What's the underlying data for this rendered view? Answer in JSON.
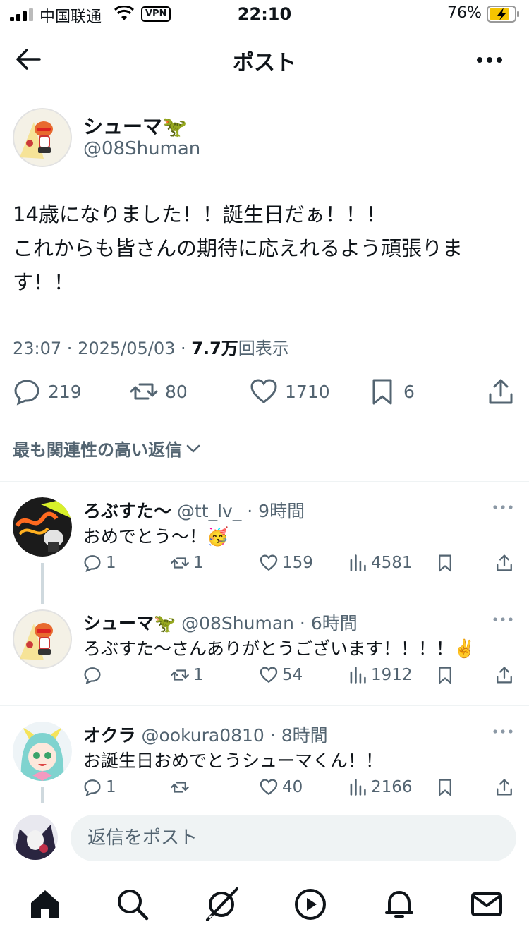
{
  "status": {
    "carrier": "中国联通",
    "vpn": "VPN",
    "time": "22:10",
    "battery": "76%"
  },
  "header": {
    "title": "ポスト"
  },
  "post": {
    "author_name": "シューマ🦖",
    "author_handle": "@08Shuman",
    "text_line1": "14歳になりました！！誕生日だぁ！！！",
    "text_line2": "これからも皆さんの期待に応えれるよう頑張りま",
    "text_line3": "す！！",
    "time": "23:07",
    "date": "2025/05/03",
    "views_count": "7.7万",
    "views_label": "回表示",
    "replies": "219",
    "reposts": "80",
    "likes": "1710",
    "bookmarks": "6"
  },
  "sort": {
    "label": "最も関連性の高い返信"
  },
  "replies": [
    {
      "name": "ろぶすた〜",
      "handle": "@tt_lv_",
      "age": "9時間",
      "text": "おめでとう〜！🥳",
      "replies": "1",
      "reposts": "1",
      "likes": "159",
      "views": "4581"
    },
    {
      "name": "シューマ🦖",
      "handle": "@08Shuman",
      "age": "6時間",
      "text": "ろぶすた〜さんありがとうございます！！！！✌️",
      "replies": "",
      "reposts": "1",
      "likes": "54",
      "views": "1912"
    },
    {
      "name": "オクラ",
      "handle": "@ookura0810",
      "age": "8時間",
      "text": "お誕生日おめでとうシューマくん！！",
      "replies": "1",
      "reposts": "",
      "likes": "40",
      "views": "2166"
    }
  ],
  "compose": {
    "placeholder": "返信をポスト"
  },
  "colors": {
    "text": "#0f1419",
    "secondary": "#536471",
    "divider": "#eff3f4"
  }
}
